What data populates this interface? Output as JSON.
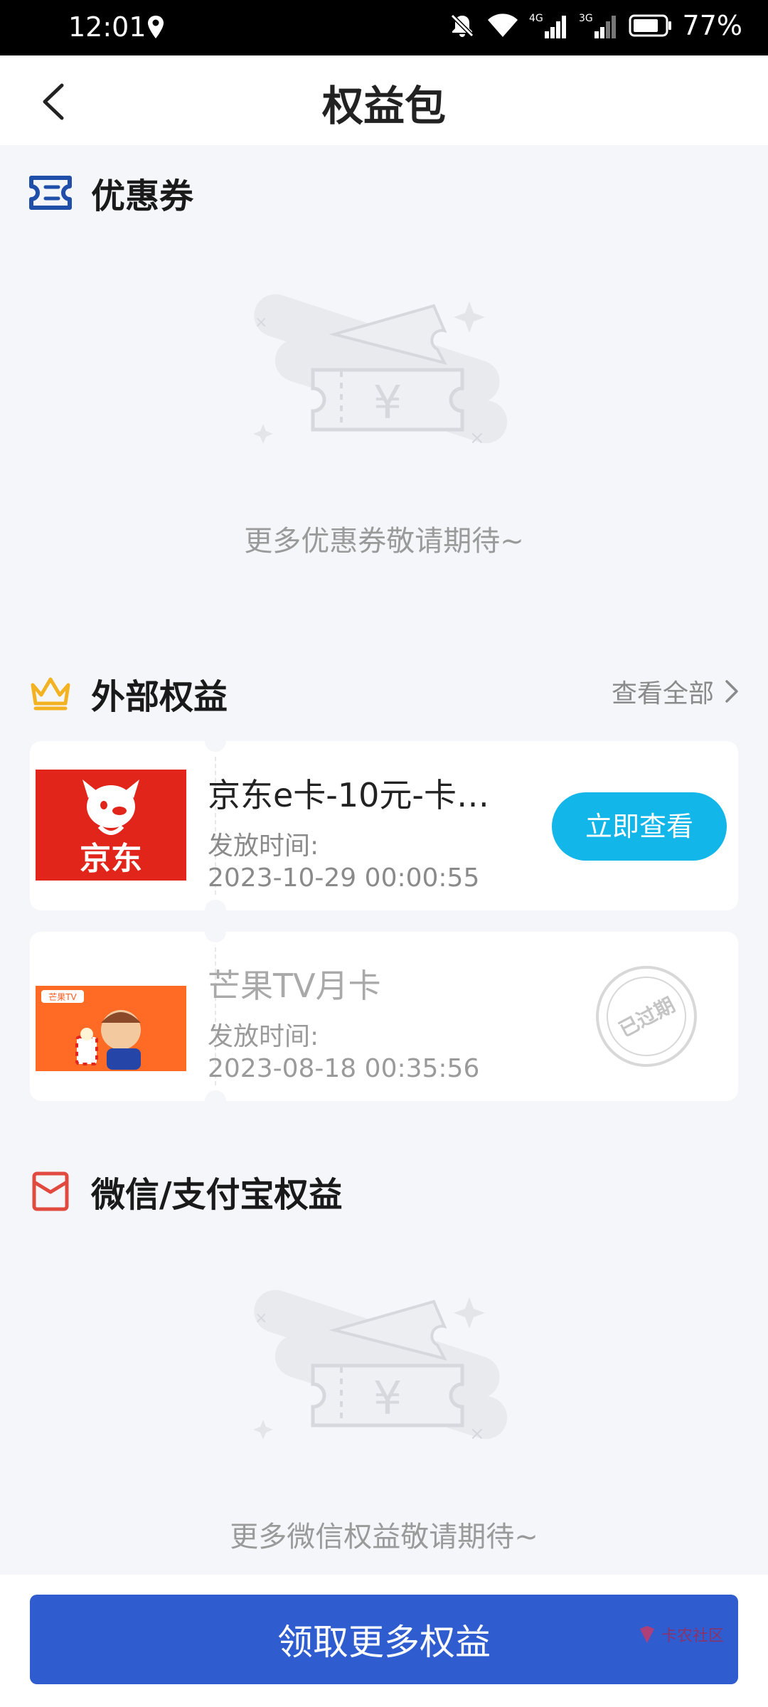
{
  "status_bar": {
    "time": "12:01",
    "battery": "77%",
    "net1": "4G",
    "net2": "3G"
  },
  "nav": {
    "title": "权益包"
  },
  "coupons": {
    "title": "优惠券",
    "empty_text": "更多优惠券敬请期待~"
  },
  "external": {
    "title": "外部权益",
    "view_all": "查看全部",
    "cards": [
      {
        "thumb_text": "京东",
        "title": "京东e卡-10元-卡…",
        "label": "发放时间:",
        "time": "2023-10-29 00:00:55",
        "action": "立即查看"
      },
      {
        "thumb_text": "芒果TV",
        "title": "芒果TV月卡",
        "label": "发放时间:",
        "time": "2023-08-18 00:35:56",
        "status": "已过期"
      }
    ]
  },
  "wechat": {
    "title": "微信/支付宝权益",
    "empty_text": "更多微信权益敬请期待~"
  },
  "bottom": {
    "claim_button": "领取更多权益",
    "watermark": "卡农社区"
  },
  "colors": {
    "accent": "#2f5ccf",
    "view_button": "#12b6e8",
    "jd_red": "#e1251b",
    "crown": "#f2b221",
    "redpacket": "#e04a3f"
  }
}
